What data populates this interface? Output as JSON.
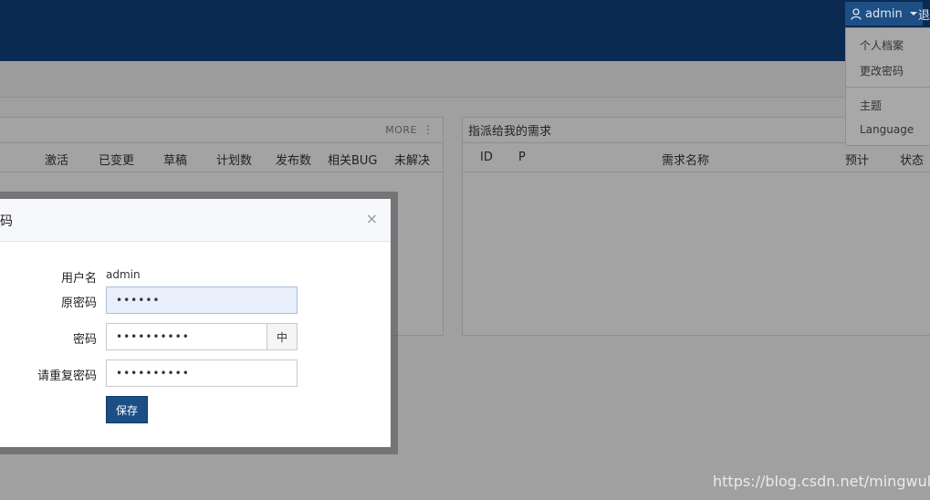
{
  "header": {
    "user_label": "admin",
    "logout_label": "退"
  },
  "left_panel": {
    "more_label": "MORE",
    "kebab": "⋮",
    "columns": [
      "激活",
      "已变更",
      "草稿",
      "计划数",
      "发布数",
      "相关BUG",
      "未解决"
    ]
  },
  "right_panel": {
    "title": "指派给我的需求",
    "columns": [
      "ID",
      "P",
      "需求名称",
      "预计",
      "状态"
    ]
  },
  "dropdown": {
    "items": [
      "个人档案",
      "更改密码",
      "主题",
      "Language"
    ]
  },
  "modal": {
    "title": "密码",
    "close": "×",
    "username_label": "用户名",
    "username_value": "admin",
    "old_password_label": "原密码",
    "old_password_value": "••••••",
    "password_label": "密码",
    "password_value": "••••••••••",
    "password_addon": "中",
    "repeat_password_label": "请重复密码",
    "repeat_password_value": "••••••••••",
    "save_label": "保存"
  },
  "watermark": "https://blog.csdn.net/mingwulipo"
}
